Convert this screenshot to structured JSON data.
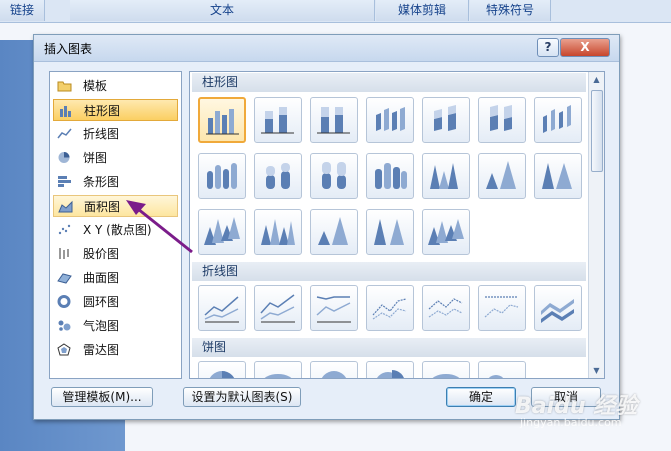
{
  "ribbon": {
    "groups": [
      "链接",
      "文本",
      "媒体剪辑",
      "特殊符号"
    ]
  },
  "dialog": {
    "title": "插入图表",
    "help_label": "?",
    "close_label": "X",
    "categories": [
      "模板",
      "柱形图",
      "折线图",
      "饼图",
      "条形图",
      "面积图",
      "X Y (散点图)",
      "股价图",
      "曲面图",
      "圆环图",
      "气泡图",
      "雷达图"
    ],
    "selected_category": "柱形图",
    "hovered_category": "面积图",
    "sections": {
      "column": "柱形图",
      "line": "折线图",
      "pie": "饼图"
    },
    "buttons": {
      "manage_templates": "管理模板(M)...",
      "set_default": "设置为默认图表(S)",
      "ok": "确定",
      "cancel": "取消"
    }
  },
  "watermark": {
    "brand": "Baidu 经验",
    "url": "jingyan.baidu.com"
  },
  "colors": {
    "accent": "#f0a93a",
    "arrow": "#7b1c8a",
    "chart_blue": "#5b7fb4"
  }
}
